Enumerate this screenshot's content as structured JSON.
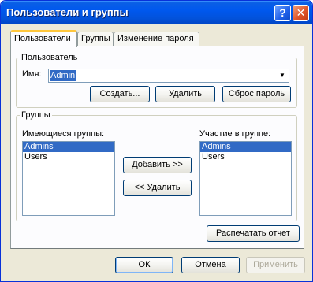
{
  "window": {
    "title": "Пользователи и группы",
    "help_button": "?",
    "close_button": "✕"
  },
  "tabs": [
    {
      "label": "Пользователи",
      "active": true
    },
    {
      "label": "Группы",
      "active": false
    },
    {
      "label": "Изменение пароля",
      "active": false
    }
  ],
  "user_group": {
    "legend": "Пользователь",
    "name_label": "Имя:",
    "name_value": "Admin",
    "create_button": "Создать...",
    "delete_button": "Удалить",
    "reset_password_button": "Сброс пароль"
  },
  "groups_group": {
    "legend": "Группы",
    "available_label": "Имеющиеся группы:",
    "available": [
      {
        "label": "Admins",
        "selected": true
      },
      {
        "label": "Users",
        "selected": false
      }
    ],
    "member_label": "Участие в группе:",
    "member": [
      {
        "label": "Admins",
        "selected": true
      },
      {
        "label": "Users",
        "selected": false
      }
    ],
    "add_button": "Добавить >>",
    "remove_button": "<< Удалить"
  },
  "print_report_button": "Распечатать отчет",
  "footer": {
    "ok_button": "ОК",
    "cancel_button": "Отмена",
    "apply_button": "Применить"
  }
}
